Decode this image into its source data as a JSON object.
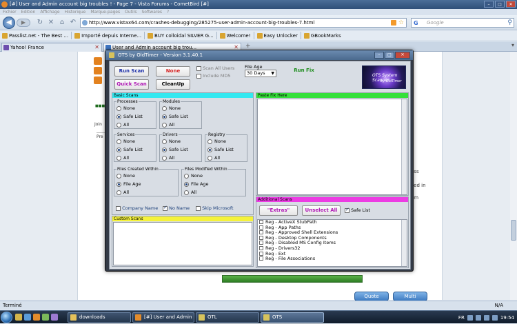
{
  "browser": {
    "title": "[#] User and Admin account big troubles ! - Page 7 - Vista Forums - CometBird [#]",
    "menu": [
      "Fichier",
      "Edition",
      "Affichage",
      "Historique",
      "Marque-pages",
      "Outils",
      "Softwares",
      "?"
    ],
    "url": "http://www.vistax64.com/crashes-debugging/285275-user-admin-account-big-troubles-7.html",
    "search_placeholder": "Google",
    "bookmarks": [
      "Passlist.net - The Best ...",
      "Importé depuis Interne...",
      "BUY colloidal SILVER G...",
      "Welcome!",
      "Easy Unlocker",
      "GBookMarks"
    ],
    "tabs": [
      {
        "label": "Yahoo! France"
      },
      {
        "label": "User and Admin account big trou..."
      }
    ],
    "status_text": "Terminé",
    "status_right": "N/A"
  },
  "page": {
    "join_label": "Join",
    "pre_label": "Pre",
    "right_text_1": "ess",
    "right_text_2": "ved in",
    "right_text_3": "em",
    "quote_button": "Quote",
    "multi_button": "Multi"
  },
  "otl": {
    "window_title": "OTS by OldTimer - Version 3.1.40.1",
    "run_scan": "Run Scan",
    "quick_scan": "Quick Scan",
    "none_button": "None",
    "cleanup_button": "CleanUp",
    "scan_all_users": "Scan All Users",
    "include_md5": "Include MD5",
    "file_age_label": "File Age",
    "file_age_value": "30 Days",
    "run_fix": "Run Fix",
    "logo_text": "OTS System Scanner",
    "logo_sub": "by OldTimer",
    "basic_scans": "Basic Scans",
    "paste_fix_here": "Paste Fix Here",
    "processes": {
      "title": "Processes",
      "options": [
        "None",
        "Safe List",
        "All"
      ]
    },
    "modules": {
      "title": "Modules",
      "options": [
        "None",
        "Safe List",
        "All"
      ]
    },
    "services": {
      "title": "Services",
      "options": [
        "None",
        "Safe List",
        "All"
      ]
    },
    "drivers": {
      "title": "Drivers",
      "options": [
        "None",
        "Safe List",
        "All"
      ]
    },
    "registry": {
      "title": "Registry",
      "options": [
        "None",
        "Safe List",
        "All"
      ]
    },
    "files_created": {
      "title": "Files Created Within",
      "options": [
        "None",
        "File Age",
        "All"
      ]
    },
    "files_modified": {
      "title": "Files Modified Within",
      "options": [
        "None",
        "File Age",
        "All"
      ]
    },
    "company_name": "Company Name",
    "no_name": "No Name",
    "skip_microsoft": "Skip Microsoft",
    "custom_scans": "Custom Scans",
    "additional_scans": "Additional Scans",
    "extras_button": "\"Extras\"",
    "unselect_all": "Unselect All",
    "safe_list": "Safe List",
    "additional_items": [
      "Reg - ActiveX StubPath",
      "Reg - App Paths",
      "Reg - Approved Shell Extensions",
      "Reg - Desktop Components",
      "Reg - Disabled MS Config Items",
      "Reg - Drivers32",
      "Reg - Ext",
      "Reg - File Associations"
    ]
  },
  "taskbar": {
    "buttons": [
      "downloads",
      "[#] User and Admin ...",
      "OTL",
      "OTS"
    ],
    "language": "FR",
    "clock": "19:54"
  },
  "colors": {
    "basic_scans_head": "#33e8f0",
    "paste_fix_head": "#34e03a",
    "custom_scans_head": "#f5f23a",
    "additional_scans_head": "#ec3ce3",
    "run_scan_text": "#1c2fa8",
    "quick_scan_text": "#b018b5",
    "none_text": "#d41f1f",
    "run_fix_text": "#1d8c1d",
    "extras_text": "#b018b5",
    "unselect_text": "#b018b5"
  }
}
